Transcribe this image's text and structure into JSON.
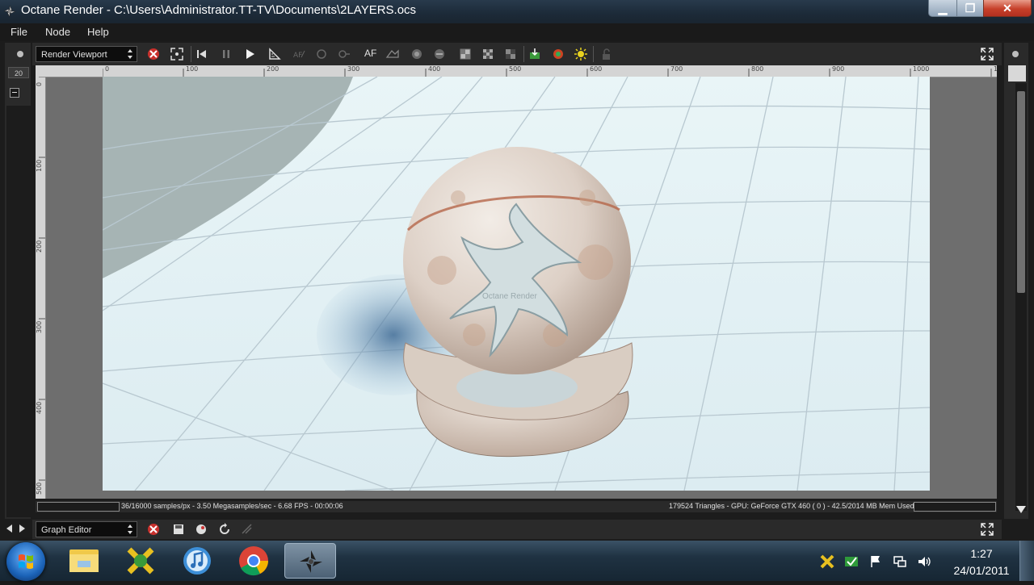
{
  "window": {
    "title": "Octane Render - C:\\Users\\Administrator.TT-TV\\Documents\\2LAYERS.ocs",
    "minimize_label": "▁",
    "maximize_label": "❐",
    "close_label": "✕"
  },
  "menu": [
    "File",
    "Node",
    "Help"
  ],
  "viewport_toolbar": {
    "combo_value": "Render Viewport",
    "af_label": "AF"
  },
  "ruler_h_ticks": [
    "0",
    "100",
    "200",
    "300",
    "400",
    "500",
    "600",
    "700",
    "800",
    "900",
    "1000",
    "1"
  ],
  "ruler_v_ticks": [
    "0",
    "100",
    "200",
    "300",
    "400",
    "500"
  ],
  "render": {
    "watermark": "Octane Render"
  },
  "status": {
    "left": "36/16000 samples/px - 3.50 Megasamples/sec - 6.68 FPS - 00:00:06",
    "right": "179524 Triangles - GPU: GeForce GTX 460 ( 0 ) - 42.5/2014 MB Mem Used"
  },
  "graph_editor": {
    "combo_value": "Graph Editor"
  },
  "side_panel": {
    "tab_label": "20"
  },
  "taskbar": {
    "time": "1:27",
    "date": "24/01/2011"
  },
  "colors": {
    "accent_close": "#c6402a",
    "panel": "#2b2b2b",
    "floor": "#dfeff3"
  }
}
